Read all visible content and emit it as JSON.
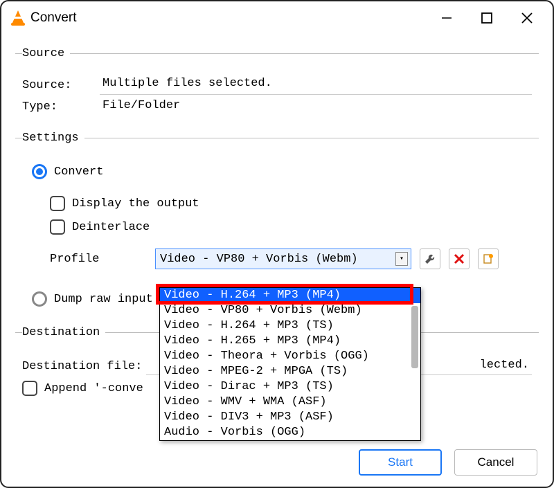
{
  "window": {
    "title": "Convert"
  },
  "source": {
    "legend": "Source",
    "source_label": "Source:",
    "source_value": "Multiple files selected.",
    "type_label": "Type:",
    "type_value": "File/Folder"
  },
  "settings": {
    "legend": "Settings",
    "convert_label": "Convert",
    "display_output_label": "Display the output",
    "deinterlace_label": "Deinterlace",
    "profile_label": "Profile",
    "profile_selected": "Video - VP80 + Vorbis (Webm)",
    "profile_options": [
      "Video - H.264 + MP3 (MP4)",
      "Video - VP80 + Vorbis (Webm)",
      "Video - H.264 + MP3 (TS)",
      "Video - H.265 + MP3 (MP4)",
      "Video - Theora + Vorbis (OGG)",
      "Video - MPEG-2 + MPGA (TS)",
      "Video - Dirac + MP3 (TS)",
      "Video - WMV + WMA (ASF)",
      "Video - DIV3 + MP3 (ASF)",
      "Audio - Vorbis (OGG)"
    ],
    "dump_label": "Dump raw input"
  },
  "destination": {
    "legend": "Destination",
    "file_label": "Destination file:",
    "file_value_fragment": "lected.",
    "append_label": "Append '-conve"
  },
  "buttons": {
    "start": "Start",
    "cancel": "Cancel"
  }
}
